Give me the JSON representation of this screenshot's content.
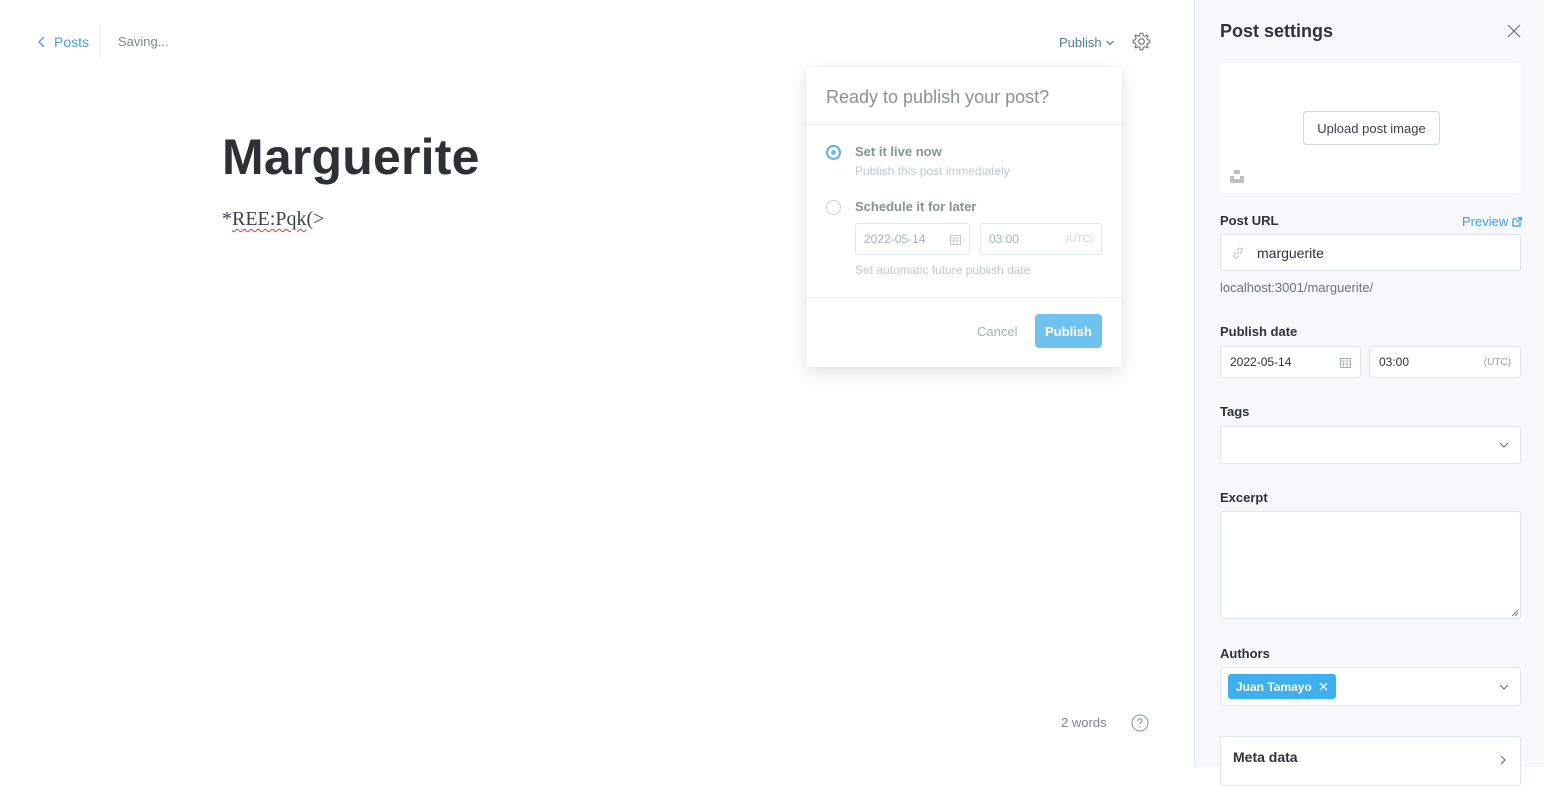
{
  "editor": {
    "back_label": "Posts",
    "status": "Saving...",
    "publish_menu_label": "Publish",
    "title": "Marguerite",
    "body_prefix": "*",
    "body_misspelled": "REE:Pqk",
    "body_suffix": "(>",
    "word_count": "2 words",
    "icons": [
      "chevron-left-icon",
      "chevron-down-icon",
      "gear-icon",
      "help-icon"
    ]
  },
  "publish_popup": {
    "heading": "Ready to publish your post?",
    "options": [
      {
        "title": "Set it live now",
        "subtitle": "Publish this post immediately",
        "selected": true
      },
      {
        "title": "Schedule it for later",
        "subtitle": "",
        "selected": false
      }
    ],
    "schedule_date": "2022-05-14",
    "schedule_time": "03:00",
    "schedule_tz": "(UTC)",
    "schedule_hint": "Set automatic future publish date",
    "cancel_label": "Cancel",
    "publish_label": "Publish",
    "accent_color": "#6fc1ee"
  },
  "settings": {
    "title": "Post settings",
    "upload_label": "Upload post image",
    "post_url_label": "Post URL",
    "preview_label": "Preview",
    "slug": "marguerite",
    "url_hint": "localhost:3001/marguerite/",
    "publish_date_label": "Publish date",
    "publish_date": "2022-05-14",
    "publish_time": "03:00",
    "publish_tz": "(UTC)",
    "tags_label": "Tags",
    "excerpt_label": "Excerpt",
    "excerpt_value": "",
    "authors_label": "Authors",
    "author": "Juan Tamayo",
    "meta_label": "Meta data",
    "accent_color": "#3eb0ef"
  }
}
